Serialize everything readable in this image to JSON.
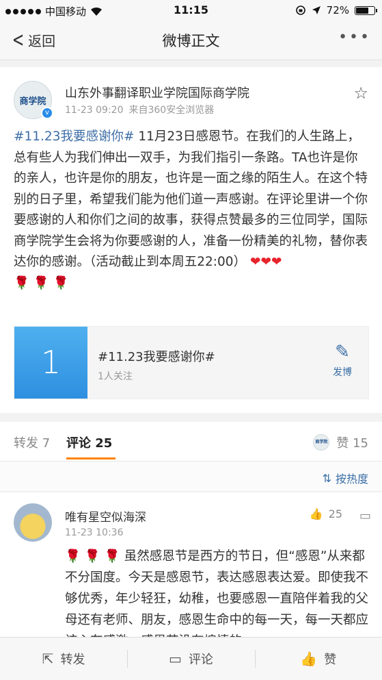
{
  "status_bar": {
    "carrier": "中国移动",
    "time": "11:15",
    "battery": "72%",
    "battery_level": 0.72,
    "icons": [
      "signal-dots-icon",
      "wifi-icon",
      "orientation-lock-icon",
      "location-arrow-icon",
      "battery-icon"
    ]
  },
  "nav": {
    "back_label": "返回",
    "title": "微博正文",
    "more_icon": "more-icon"
  },
  "post": {
    "author": "山东外事翻译职业学院国际商学院",
    "avatar_text": "商学院",
    "time": "11-23 09:20",
    "source": "来自360安全浏览器",
    "hashtag": "#11.23我要感谢你#",
    "text": " 11月23日感恩节。在我们的人生路上，总有些人为我们伸出一双手，为我们指引一条路。TA也许是你的亲人，也许是你的朋友，也许是一面之缘的陌生人。在这个特别的日子里，希望我们能为他们道一声感谢。在评论里讲一个你要感谢的人和你们之间的故事，获得点赞最多的三位同学，国际商学院学生会将为你要感谢的人，准备一份精美的礼物，替你表达你的感谢。（活动截止到本周五22:00）",
    "hearts": "❤❤❤",
    "roses": "🌹 🌹 🌹"
  },
  "topic": {
    "number": "1",
    "title": "#11.23我要感谢你#",
    "followers": "1人关注",
    "action_label": "发博"
  },
  "tabs": {
    "repost_label": "转发",
    "repost_count": "7",
    "comment_label": "评论",
    "comment_count": "25",
    "like_label": "赞",
    "like_count": "15"
  },
  "sort": {
    "label": "按热度"
  },
  "comment": {
    "name": "唯有星空似海深",
    "time": "11-23 10:36",
    "likes": "25",
    "roses": "🌹 🌹 🌹",
    "text": "   虽然感恩节是西方的节日，但“感恩”从来都不分国度。今天是感恩节，表达感恩表达爱。即使我不够优秀，年少轻狂，幼稚，也要感恩一直陪伴着我的父母还有老师、朋友，感恩生命中的每一天，每一天都应该心存感激，感恩节没有煽情的"
  },
  "bottom_bar": {
    "repost": "转发",
    "comment": "评论",
    "like": "赞"
  }
}
